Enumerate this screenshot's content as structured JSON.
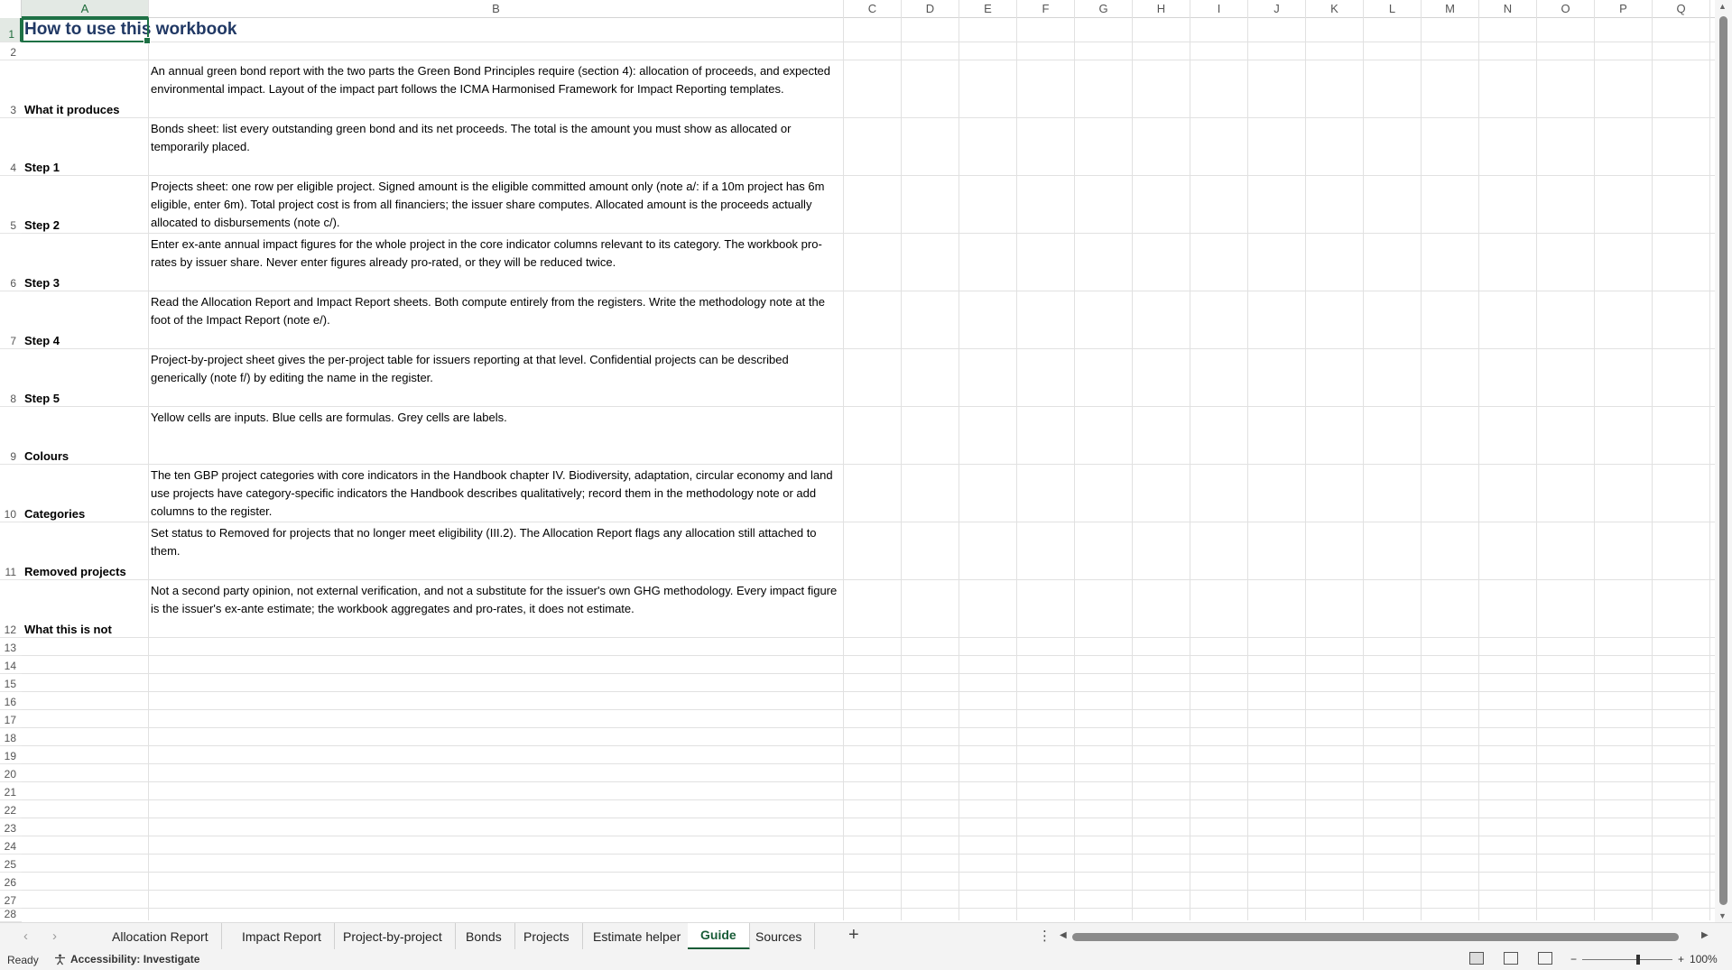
{
  "columns": [
    "A",
    "B",
    "C",
    "D",
    "E",
    "F",
    "G",
    "H",
    "I",
    "J",
    "K",
    "L",
    "M",
    "N",
    "O",
    "P",
    "Q"
  ],
  "selected_column": "A",
  "selected_row": "1",
  "sheet": {
    "title": "How to use this workbook",
    "rows": [
      {
        "num": "1"
      },
      {
        "num": "2"
      },
      {
        "num": "3",
        "label": "What it produces",
        "text": "An annual green bond report with the two parts the Green Bond Principles require (section 4): allocation of proceeds, and expected environmental impact. Layout of the impact part follows the ICMA Harmonised Framework for Impact Reporting templates."
      },
      {
        "num": "4",
        "label": "Step 1",
        "text": "Bonds sheet: list every outstanding green bond and its net proceeds. The total is the amount you must show as allocated or temporarily placed."
      },
      {
        "num": "5",
        "label": "Step 2",
        "text": "Projects sheet: one row per eligible project. Signed amount is the eligible committed amount only (note a/: if a 10m project has 6m eligible, enter 6m). Total project cost is from all financiers; the issuer share computes. Allocated amount is the proceeds actually allocated to disbursements (note c/)."
      },
      {
        "num": "6",
        "label": "Step 3",
        "text": "Enter ex-ante annual impact figures for the whole project in the core indicator columns relevant to its category. The workbook pro-rates by issuer share. Never enter figures already pro-rated, or they will be reduced twice."
      },
      {
        "num": "7",
        "label": "Step 4",
        "text": "Read the Allocation Report and Impact Report sheets. Both compute entirely from the registers. Write the methodology note at the foot of the Impact Report (note e/)."
      },
      {
        "num": "8",
        "label": "Step 5",
        "text": "Project-by-project sheet gives the per-project table for issuers reporting at that level. Confidential projects can be described generically (note f/) by editing the name in the register."
      },
      {
        "num": "9",
        "label": "Colours",
        "text": "Yellow cells are inputs. Blue cells are formulas. Grey cells are labels."
      },
      {
        "num": "10",
        "label": "Categories",
        "text": "The ten GBP project categories with core indicators in the Handbook chapter IV. Biodiversity, adaptation, circular economy and land use projects have category-specific indicators the Handbook describes qualitatively; record them in the methodology note or add columns to the register."
      },
      {
        "num": "11",
        "label": "Removed projects",
        "text": "Set status to Removed for projects that no longer meet eligibility (III.2). The Allocation Report flags any allocation still attached to them."
      },
      {
        "num": "12",
        "label": "What this is not",
        "text": "Not a second party opinion, not external verification, and not a substitute for the issuer's own GHG methodology. Every impact figure is the issuer's ex-ante estimate; the workbook aggregates and pro-rates, it does not estimate."
      },
      {
        "num": "13"
      },
      {
        "num": "14"
      },
      {
        "num": "15"
      },
      {
        "num": "16"
      },
      {
        "num": "17"
      },
      {
        "num": "18"
      },
      {
        "num": "19"
      },
      {
        "num": "20"
      },
      {
        "num": "21"
      },
      {
        "num": "22"
      },
      {
        "num": "23"
      },
      {
        "num": "24"
      },
      {
        "num": "25"
      },
      {
        "num": "26"
      },
      {
        "num": "27"
      },
      {
        "num": "28"
      }
    ]
  },
  "tabs": [
    "Allocation Report",
    "Impact Report",
    "Project-by-project",
    "Bonds",
    "Projects",
    "Estimate helper",
    "Guide",
    "Sources"
  ],
  "active_tab": "Guide",
  "status": {
    "ready": "Ready",
    "accessibility": "Accessibility: Investigate",
    "zoom": "100%"
  },
  "colors": {
    "accent": "#1e7145",
    "title": "#203864"
  }
}
